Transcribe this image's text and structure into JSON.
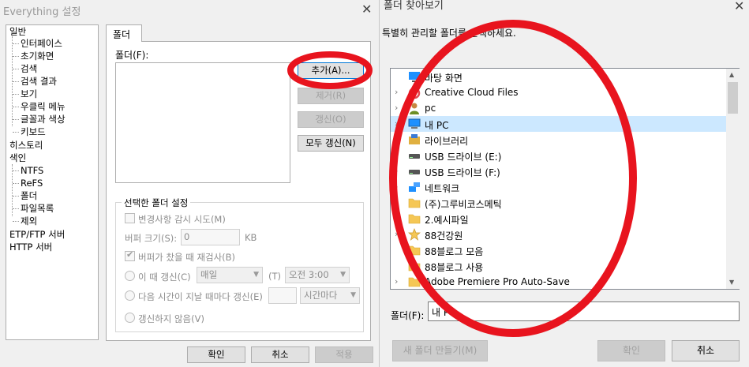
{
  "left_window": {
    "title": "Everything 설정",
    "close": "✕",
    "tree": {
      "general": "일반",
      "general_children": [
        "인터페이스",
        "초기화면",
        "검색",
        "검색 결과",
        "보기",
        "우클릭 메뉴",
        "글꼴과 색상",
        "키보드"
      ],
      "history": "히스토리",
      "index": "색인",
      "index_children": [
        "NTFS",
        "ReFS",
        "폴더",
        "파일목록",
        "제외"
      ],
      "etp": "ETP/FTP 서버",
      "http": "HTTP 서버"
    },
    "tab_label": "폴더",
    "folder_label": "폴더(F):",
    "buttons": {
      "add": "추가(A)...",
      "remove": "제거(R)",
      "update": "갱신(O)",
      "update_all": "모두 갱신(N)"
    },
    "group": {
      "title": "선택한 폴더 설정",
      "monitor_changes": "변경사항 감시 시도(M)",
      "buffer_size_label": "버퍼 크기(S):",
      "buffer_size_value": "0",
      "buffer_unit": "KB",
      "rescan_full": "버퍼가 찼을 때 재검사(B)",
      "update_at": "이 때 갱신(C)",
      "update_at_freq": "매일",
      "update_at_t": "(T)",
      "update_at_time": "오전 3:00",
      "update_every": "다음 시간이 지날 때마다 갱신(E)",
      "update_every_unit": "시간마다",
      "dont_update": "갱신하지 않음(V)"
    },
    "footer": {
      "ok": "확인",
      "cancel": "취소",
      "apply": "적용"
    }
  },
  "right_window": {
    "title": "폴더 찾아보기",
    "close": "✕",
    "instructions": "특별히 관리할 폴더를 선택하세요.",
    "tree_items": [
      {
        "label": "바탕 화면",
        "icon": "desktop-icon",
        "chevron": "",
        "color": "#1e90ff"
      },
      {
        "label": "Creative Cloud Files",
        "icon": "creative-cloud-icon",
        "chevron": "›",
        "color": "#e34850"
      },
      {
        "label": "pc",
        "icon": "user-icon",
        "chevron": "›",
        "color": "#6b8e23"
      },
      {
        "label": "내 PC",
        "icon": "computer-icon",
        "chevron": "›",
        "color": "#1e90ff"
      },
      {
        "label": "라이브러리",
        "icon": "library-icon",
        "chevron": "›",
        "color": "#e0b040"
      },
      {
        "label": "USB 드라이브 (E:)",
        "icon": "usb-drive-icon",
        "chevron": "›",
        "color": "#555555"
      },
      {
        "label": "USB 드라이브 (F:)",
        "icon": "usb-drive-icon",
        "chevron": "›",
        "color": "#555555"
      },
      {
        "label": "네트워크",
        "icon": "network-icon",
        "chevron": "›",
        "color": "#1e90ff"
      },
      {
        "label": "(주)그루비코스메틱",
        "icon": "folder-icon",
        "chevron": "",
        "color": "#f5c755"
      },
      {
        "label": "2.예시파일",
        "icon": "folder-icon",
        "chevron": "",
        "color": "#f5c755"
      },
      {
        "label": "88건강원",
        "icon": "star-folder-icon",
        "chevron": "›",
        "color": "#f5c755"
      },
      {
        "label": "88블로그 모음",
        "icon": "folder-icon",
        "chevron": "",
        "color": "#f5c755"
      },
      {
        "label": "88블로그 사용",
        "icon": "folder-icon",
        "chevron": "",
        "color": "#f5c755"
      },
      {
        "label": "Adobe Premiere Pro Auto-Save",
        "icon": "folder-icon",
        "chevron": "›",
        "color": "#f5c755"
      }
    ],
    "selected_index": 3,
    "folder_label": "폴더(F):",
    "folder_value": "내 PC",
    "buttons": {
      "new_folder": "새 폴더 만들기(M)",
      "ok": "확인",
      "cancel": "취소"
    }
  },
  "annotation_color": "#e8141e"
}
